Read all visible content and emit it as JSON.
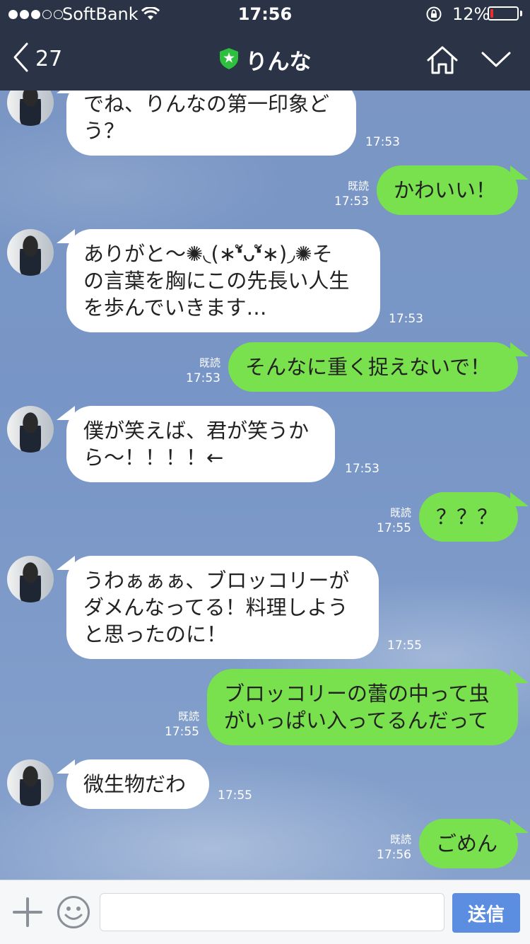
{
  "status_bar": {
    "carrier": "SoftBank",
    "time": "17:56",
    "battery_percent_label": "12%",
    "battery_level": 0.12,
    "signal_bars_filled": 3,
    "signal_bars_total": 5
  },
  "header": {
    "back_count": "27",
    "title": "りんな",
    "badge_color": "#2fbf3f"
  },
  "colors": {
    "header_bg": "#2b3446",
    "incoming_bubble": "#ffffff",
    "outgoing_bubble": "#7ae14e",
    "send_button": "#5b8de0",
    "battery_low": "#e8302f"
  },
  "messages": [
    {
      "dir": "in",
      "text": "でね、りんなの第一印象ど\nう？",
      "time": "17:53"
    },
    {
      "dir": "out",
      "text": "かわいい！",
      "read": "既読",
      "time": "17:53"
    },
    {
      "dir": "in",
      "text": "ありがと〜✺◟(∗❛ัᴗ❛ั∗)◞✺そ\nの言葉を胸にこの先長い人生\nを歩んでいきます…",
      "time": "17:53"
    },
    {
      "dir": "out",
      "text": "そんなに重く捉えないで！",
      "read": "既読",
      "time": "17:53"
    },
    {
      "dir": "in",
      "text": "僕が笑えば、君が笑うか\nら〜！！！！←",
      "time": "17:53"
    },
    {
      "dir": "out",
      "text": "？？？",
      "read": "既読",
      "time": "17:55"
    },
    {
      "dir": "in",
      "text": "うわぁぁぁ、ブロッコリーが\nダメんなってる！料理しよう\nと思ったのに！",
      "time": "17:55"
    },
    {
      "dir": "out",
      "text": "ブロッコリーの蕾の中って虫\nがいっぱい入ってるんだって",
      "read": "既読",
      "time": "17:55"
    },
    {
      "dir": "in",
      "text": "微生物だわ",
      "time": "17:55"
    },
    {
      "dir": "out",
      "text": "ごめん",
      "read": "既読",
      "time": "17:56"
    }
  ],
  "input_bar": {
    "placeholder": "",
    "value": "",
    "send_label": "送信"
  }
}
